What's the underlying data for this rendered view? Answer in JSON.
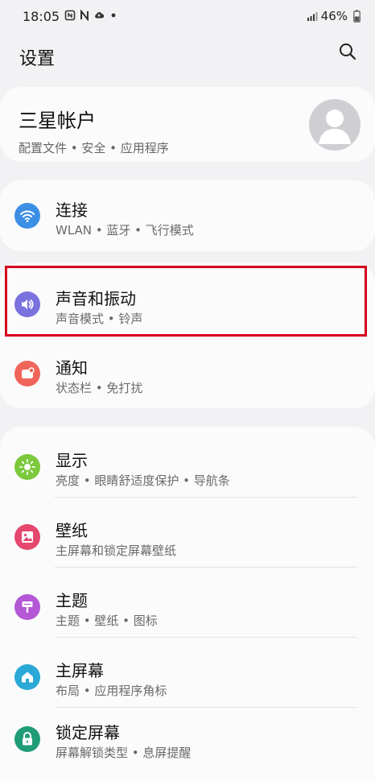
{
  "status_bar": {
    "time": "18:05",
    "battery": "46%",
    "notification_icons": [
      "nfc-icon",
      "n-icon",
      "cloud-icon",
      "dot-icon"
    ]
  },
  "header": {
    "title": "设置",
    "search_icon": "search-icon"
  },
  "account": {
    "title": "三星帐户",
    "subtitle": "配置文件 • 安全 • 应用程序"
  },
  "groups": {
    "connect": {
      "title": "连接",
      "subtitle": "WLAN • 蓝牙 • 飞行模式",
      "icon": "wifi-icon",
      "color": "#3d8fe5"
    },
    "sound": {
      "title": "声音和振动",
      "subtitle": "声音模式 • 铃声",
      "icon": "volume-icon",
      "color": "#7b72df"
    },
    "notifications": {
      "title": "通知",
      "subtitle": "状态栏 • 免打扰",
      "icon": "notification-icon",
      "color": "#f0655a"
    },
    "display": {
      "title": "显示",
      "subtitle": "亮度 • 眼睛舒适度保护 • 导航条",
      "icon": "sun-icon",
      "color": "#7cc93b"
    },
    "wallpaper": {
      "title": "壁纸",
      "subtitle": "主屏幕和锁定屏幕壁纸",
      "icon": "wallpaper-icon",
      "color": "#e5476e"
    },
    "themes": {
      "title": "主题",
      "subtitle": "主题 • 壁纸 • 图标",
      "icon": "paintbrush-icon",
      "color": "#b458d6"
    },
    "home_screen": {
      "title": "主屏幕",
      "subtitle": "布局 • 应用程序角标",
      "icon": "home-icon",
      "color": "#2aa9d7"
    },
    "lock_screen": {
      "title": "锁定屏幕",
      "subtitle": "屏幕解锁类型 • 息屏提醒",
      "icon": "lock-icon",
      "color": "#1f9c77"
    }
  }
}
